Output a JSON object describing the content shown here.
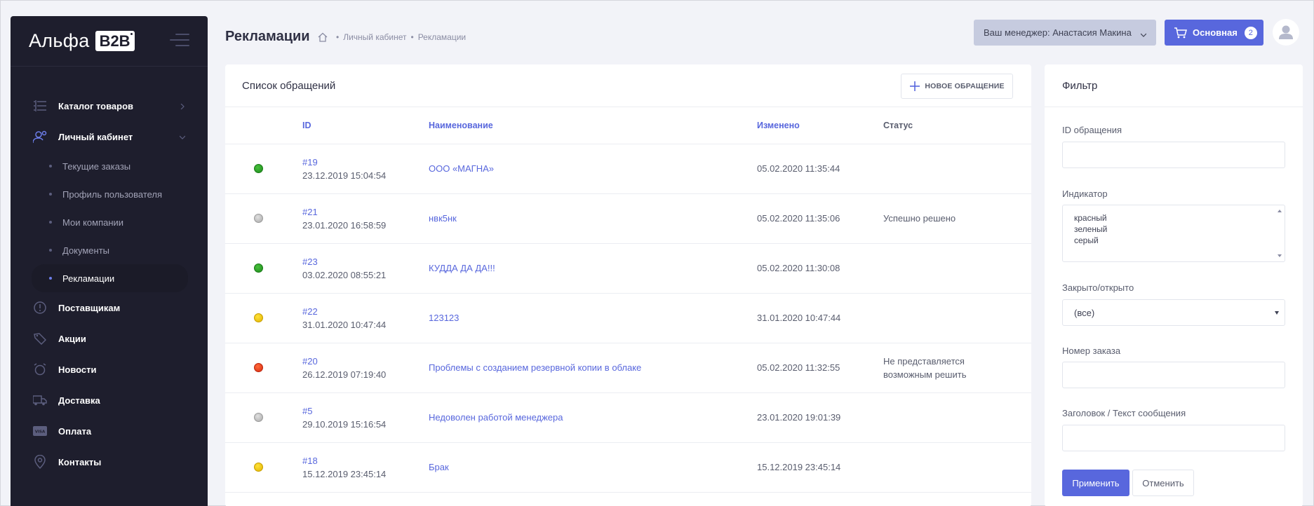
{
  "brand": {
    "name": "Альфа",
    "badge": "B2B"
  },
  "sidebar": {
    "items": [
      {
        "label": "Каталог товаров",
        "icon": "list-icon",
        "has_chevron": true,
        "chevron": "right"
      },
      {
        "label": "Личный кабинет",
        "icon": "user-settings-icon",
        "has_chevron": true,
        "chevron": "down"
      }
    ],
    "subitems": [
      {
        "label": "Текущие заказы"
      },
      {
        "label": "Профиль пользователя"
      },
      {
        "label": "Мои компании"
      },
      {
        "label": "Документы"
      },
      {
        "label": "Рекламации",
        "active": true
      }
    ],
    "items_after": [
      {
        "label": "Поставщикам",
        "icon": "info-circle-icon"
      },
      {
        "label": "Акции",
        "icon": "tag-icon"
      },
      {
        "label": "Новости",
        "icon": "alarm-clock-icon"
      },
      {
        "label": "Доставка",
        "icon": "truck-icon"
      },
      {
        "label": "Оплата",
        "icon": "visa-card-icon"
      },
      {
        "label": "Контакты",
        "icon": "map-pin-icon"
      }
    ]
  },
  "header": {
    "title": "Рекламации",
    "breadcrumb": [
      "Личный кабинет",
      "Рекламации"
    ],
    "manager": "Ваш менеджер: Анастасия Макина",
    "cart_label": "Основная",
    "cart_count": "2"
  },
  "list": {
    "title": "Список обращений",
    "new_button": "НОВОЕ ОБРАЩЕНИЕ",
    "columns": {
      "id": "ID",
      "name": "Наименование",
      "changed": "Изменено",
      "status": "Статус"
    },
    "rows": [
      {
        "indicator": "green",
        "id": "#19",
        "date": "23.12.2019 15:04:54",
        "name": "ООО «МАГНА»",
        "changed": "05.02.2020 11:35:44",
        "status": ""
      },
      {
        "indicator": "grey",
        "id": "#21",
        "date": "23.01.2020 16:58:59",
        "name": "нвк5нк",
        "changed": "05.02.2020 11:35:06",
        "status": "Успешно решено"
      },
      {
        "indicator": "green",
        "id": "#23",
        "date": "03.02.2020 08:55:21",
        "name": "КУДДА ДА ДА!!!",
        "changed": "05.02.2020 11:30:08",
        "status": ""
      },
      {
        "indicator": "yellow",
        "id": "#22",
        "date": "31.01.2020 10:47:44",
        "name": "123123",
        "changed": "31.01.2020 10:47:44",
        "status": ""
      },
      {
        "indicator": "red",
        "id": "#20",
        "date": "26.12.2019 07:19:40",
        "name": "Проблемы с созданием резервной копии в облаке",
        "changed": "05.02.2020 11:32:55",
        "status": "Не представляется возможным решить"
      },
      {
        "indicator": "grey",
        "id": "#5",
        "date": "29.10.2019 15:16:54",
        "name": "Недоволен работой менеджера",
        "changed": "23.01.2020 19:01:39",
        "status": ""
      },
      {
        "indicator": "yellow",
        "id": "#18",
        "date": "15.12.2019 23:45:14",
        "name": "Брак",
        "changed": "15.12.2019 23:45:14",
        "status": ""
      }
    ]
  },
  "filter": {
    "title": "Фильтр",
    "id_label": "ID обращения",
    "id_value": "",
    "indicator_label": "Индикатор",
    "indicator_options": [
      "красный",
      "зеленый",
      "серый"
    ],
    "closed_label": "Закрыто/открыто",
    "closed_value": "(все)",
    "order_label": "Номер заказа",
    "order_value": "",
    "text_label": "Заголовок / Текст сообщения",
    "text_value": "",
    "apply": "Применить",
    "cancel": "Отменить"
  },
  "colors": {
    "accent": "#5867dd",
    "sidebar_bg": "#1e1e2d",
    "page_bg": "#f2f3f8",
    "manager_bg": "#c6cbdf"
  }
}
